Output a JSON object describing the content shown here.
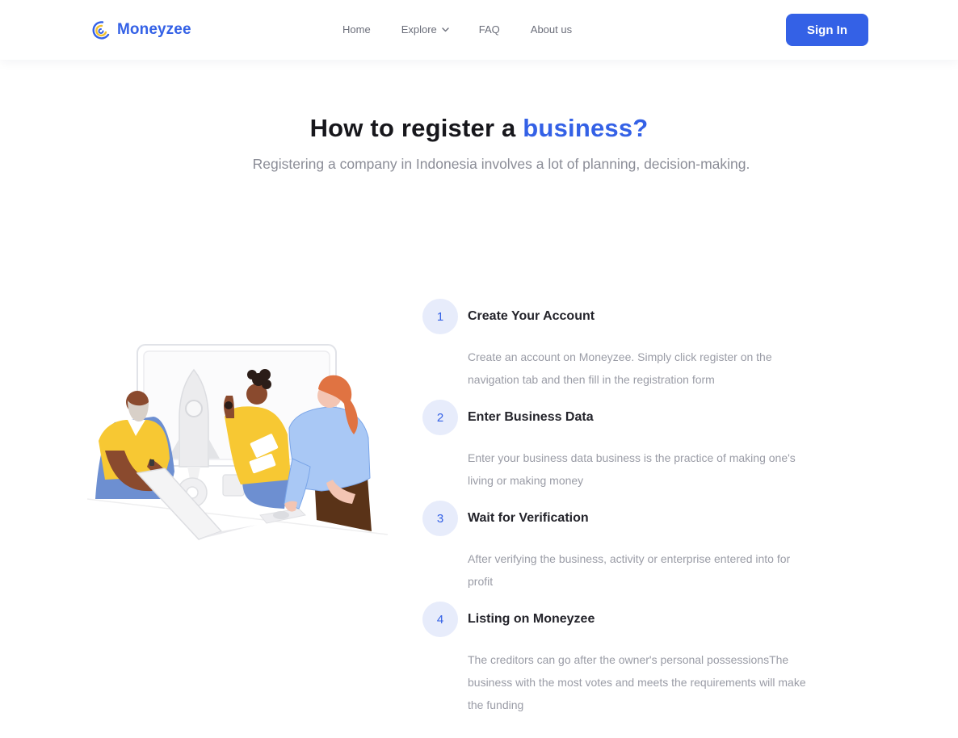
{
  "brand": {
    "name": "Moneyzee",
    "icon": "moneyzee-logo-icon"
  },
  "nav": {
    "items": [
      {
        "label": "Home"
      },
      {
        "label": "Explore",
        "icon": "chevron-down-icon"
      },
      {
        "label": "FAQ"
      },
      {
        "label": "About us"
      }
    ],
    "signin_label": "Sign In"
  },
  "hero": {
    "title_main": "How to register a ",
    "title_accent": "business?",
    "subtitle": "Registering a company in Indonesia involves a lot of planning, decision-making."
  },
  "steps": [
    {
      "number": "1",
      "title": "Create Your Account",
      "description": "Create an account on Moneyzee. Simply click register on the navigation tab and then fill in the registration form"
    },
    {
      "number": "2",
      "title": "Enter Business Data",
      "description": "Enter your business data business is the practice of making one's living or making money"
    },
    {
      "number": "3",
      "title": "Wait for Verification",
      "description": "After verifying the business, activity or enterprise entered into for profit"
    },
    {
      "number": "4",
      "title": "Listing on Moneyzee",
      "description": "The creditors can go after the owner's personal possessionsThe business with the most votes and meets the requirements will make the funding"
    }
  ],
  "colors": {
    "accent": "#3461e6",
    "badge_bg": "#e7ecfb",
    "heading": "#17171c",
    "muted": "#8b8d97",
    "logo_yellow": "#f2c12e"
  },
  "illustration": {
    "icon": "team-rocket-illustration"
  }
}
